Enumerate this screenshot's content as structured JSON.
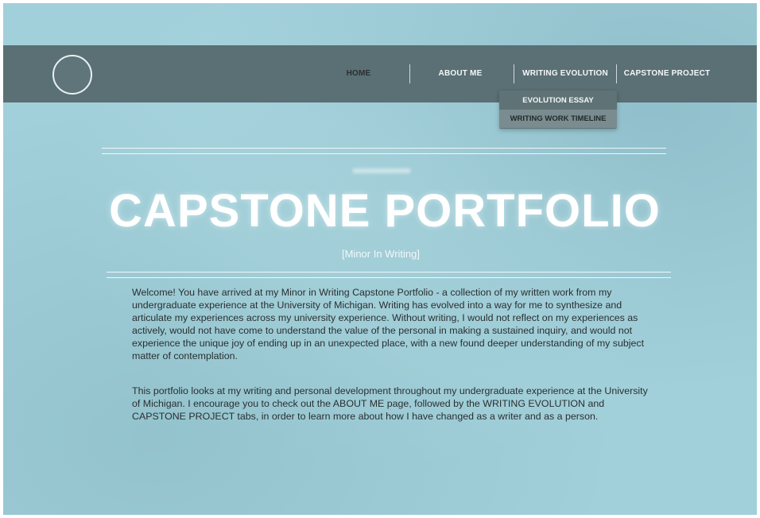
{
  "nav": {
    "items": [
      {
        "label": "HOME",
        "active": true
      },
      {
        "label": "ABOUT ME"
      },
      {
        "label": "WRITING EVOLUTION"
      },
      {
        "label": "CAPSTONE PROJECT"
      }
    ],
    "dropdown": [
      {
        "label": "EVOLUTION ESSAY"
      },
      {
        "label": "WRITING WORK TIMELINE",
        "highlighted": true
      }
    ]
  },
  "hero": {
    "title": "CAPSTONE PORTFOLIO",
    "subtitle": "[Minor In Writing]"
  },
  "content": {
    "paragraph_1": "Welcome! You have arrived at my Minor in Writing Capstone Portfolio - a collection of my written work from my undergraduate experience at the University of Michigan. Writing has evolved into a way for me to synthesize and articulate my experiences across my university experience. Without writing, I would not reflect on my experiences as actively, would not have come to understand the value of the personal in making a sustained inquiry, and would not experience the unique joy of ending up in an unexpected place, with a new found deeper understanding of my subject matter of contemplation.",
    "paragraph_2": "This portfolio looks at my writing and personal development throughout my undergraduate experience at the University of Michigan. I encourage you to check out the ABOUT ME page, followed by the WRITING EVOLUTION and CAPSTONE PROJECT tabs, in order to learn more about how I have changed as a writer and as a person."
  },
  "colors": {
    "background": "#a2d0da",
    "navbar": "#5a7074",
    "dropdown": "#5f7377",
    "text": "#2a2f31"
  }
}
